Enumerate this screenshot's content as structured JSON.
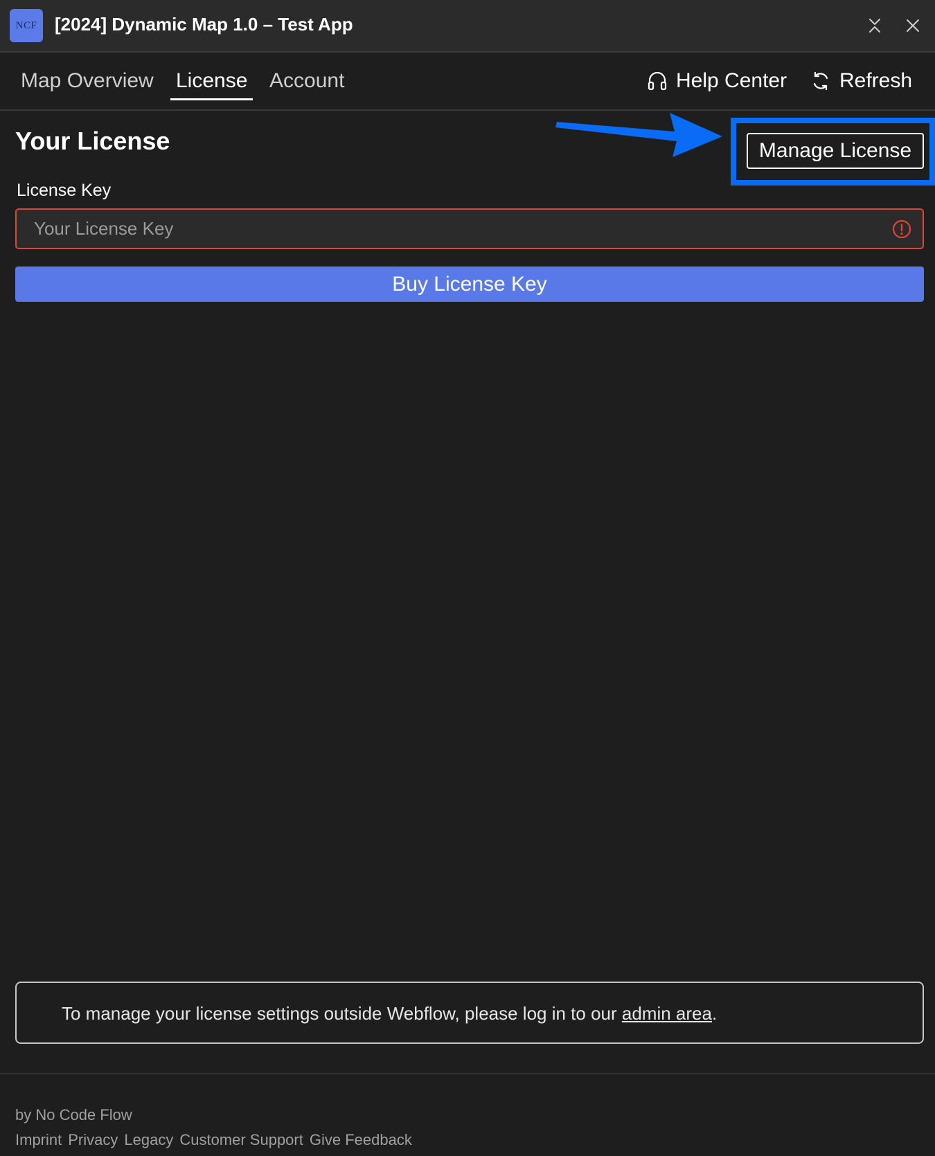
{
  "window": {
    "logo_text": "NCF",
    "title": "[2024] Dynamic Map 1.0 – Test App"
  },
  "nav": {
    "tabs": [
      {
        "label": "Map Overview",
        "active": false
      },
      {
        "label": "License",
        "active": true
      },
      {
        "label": "Account",
        "active": false
      }
    ],
    "help_label": "Help Center",
    "refresh_label": "Refresh"
  },
  "license": {
    "title": "Your License",
    "manage_label": "Manage License",
    "key_label": "License Key",
    "key_value": "",
    "key_placeholder": "Your License Key",
    "buy_label": "Buy License Key"
  },
  "info": {
    "text_before": "To manage your license settings outside Webflow, please log in to our ",
    "link_label": "admin area",
    "text_after": "."
  },
  "footer": {
    "by": "by No Code Flow",
    "links": [
      "Imprint",
      "Privacy",
      "Legacy",
      "Customer Support",
      "Give Feedback"
    ]
  },
  "colors": {
    "accent": "#5a79e9",
    "error": "#e0453a",
    "annotation": "#0a6cf5",
    "background": "#1e1e1e"
  }
}
